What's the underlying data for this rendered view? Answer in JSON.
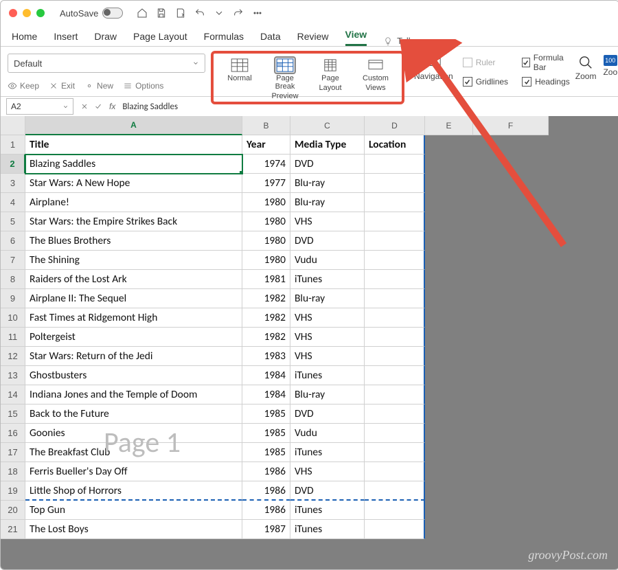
{
  "titlebar": {
    "autosave": "AutoSave"
  },
  "menu": {
    "tabs": [
      "Home",
      "Insert",
      "Draw",
      "Page Layout",
      "Formulas",
      "Data",
      "Review",
      "View"
    ],
    "active": "View",
    "tellme": "Tell me"
  },
  "ribbon": {
    "style": "Default",
    "small": [
      "Keep",
      "Exit",
      "New",
      "Options"
    ],
    "views": {
      "normal": "Normal",
      "pagebreak_l1": "Page Break",
      "pagebreak_l2": "Preview",
      "pagelayout_l1": "Page",
      "pagelayout_l2": "Layout",
      "custom_l1": "Custom",
      "custom_l2": "Views"
    },
    "navigation": "Navigation",
    "checks": {
      "ruler": "Ruler",
      "formula": "Formula Bar",
      "gridlines": "Gridlines",
      "headings": "Headings"
    },
    "zoom": "Zoom",
    "zoom100": "Zoo",
    "z100": "100"
  },
  "formula": {
    "name": "A2",
    "text": "Blazing Saddles"
  },
  "columns": [
    "A",
    "B",
    "C",
    "D",
    "E",
    "F"
  ],
  "headers": {
    "a": "Title",
    "b": "Year",
    "c": "Media Type",
    "d": "Location"
  },
  "rows": [
    {
      "n": "1"
    },
    {
      "n": "2",
      "a": "Blazing Saddles",
      "b": "1974",
      "c": "DVD"
    },
    {
      "n": "3",
      "a": "Star Wars: A New Hope",
      "b": "1977",
      "c": "Blu-ray"
    },
    {
      "n": "4",
      "a": "Airplane!",
      "b": "1980",
      "c": "Blu-ray"
    },
    {
      "n": "5",
      "a": "Star Wars: the Empire Strikes Back",
      "b": "1980",
      "c": "VHS"
    },
    {
      "n": "6",
      "a": "The Blues Brothers",
      "b": "1980",
      "c": "DVD"
    },
    {
      "n": "7",
      "a": "The Shining",
      "b": "1980",
      "c": "Vudu"
    },
    {
      "n": "8",
      "a": "Raiders of the Lost Ark",
      "b": "1981",
      "c": "iTunes"
    },
    {
      "n": "9",
      "a": "Airplane II: The Sequel",
      "b": "1982",
      "c": "Blu-ray"
    },
    {
      "n": "10",
      "a": "Fast Times at Ridgemont High",
      "b": "1982",
      "c": "VHS"
    },
    {
      "n": "11",
      "a": "Poltergeist",
      "b": "1982",
      "c": "VHS"
    },
    {
      "n": "12",
      "a": "Star Wars: Return of the Jedi",
      "b": "1983",
      "c": "VHS"
    },
    {
      "n": "13",
      "a": "Ghostbusters",
      "b": "1984",
      "c": "iTunes"
    },
    {
      "n": "14",
      "a": "Indiana Jones and the Temple of Doom",
      "b": "1984",
      "c": "Blu-ray"
    },
    {
      "n": "15",
      "a": "Back to the Future",
      "b": "1985",
      "c": "DVD"
    },
    {
      "n": "16",
      "a": "Goonies",
      "b": "1985",
      "c": "Vudu"
    },
    {
      "n": "17",
      "a": "The Breakfast Club",
      "b": "1985",
      "c": "iTunes"
    },
    {
      "n": "18",
      "a": "Ferris Bueller's Day Off",
      "b": "1986",
      "c": "VHS"
    },
    {
      "n": "19",
      "a": "Little Shop of Horrors",
      "b": "1986",
      "c": "DVD"
    },
    {
      "n": "20",
      "a": "Top Gun",
      "b": "1986",
      "c": "iTunes"
    },
    {
      "n": "21",
      "a": "The Lost Boys",
      "b": "1987",
      "c": "iTunes"
    }
  ],
  "watermark": "Page 1",
  "credit": "groovyPost.com"
}
